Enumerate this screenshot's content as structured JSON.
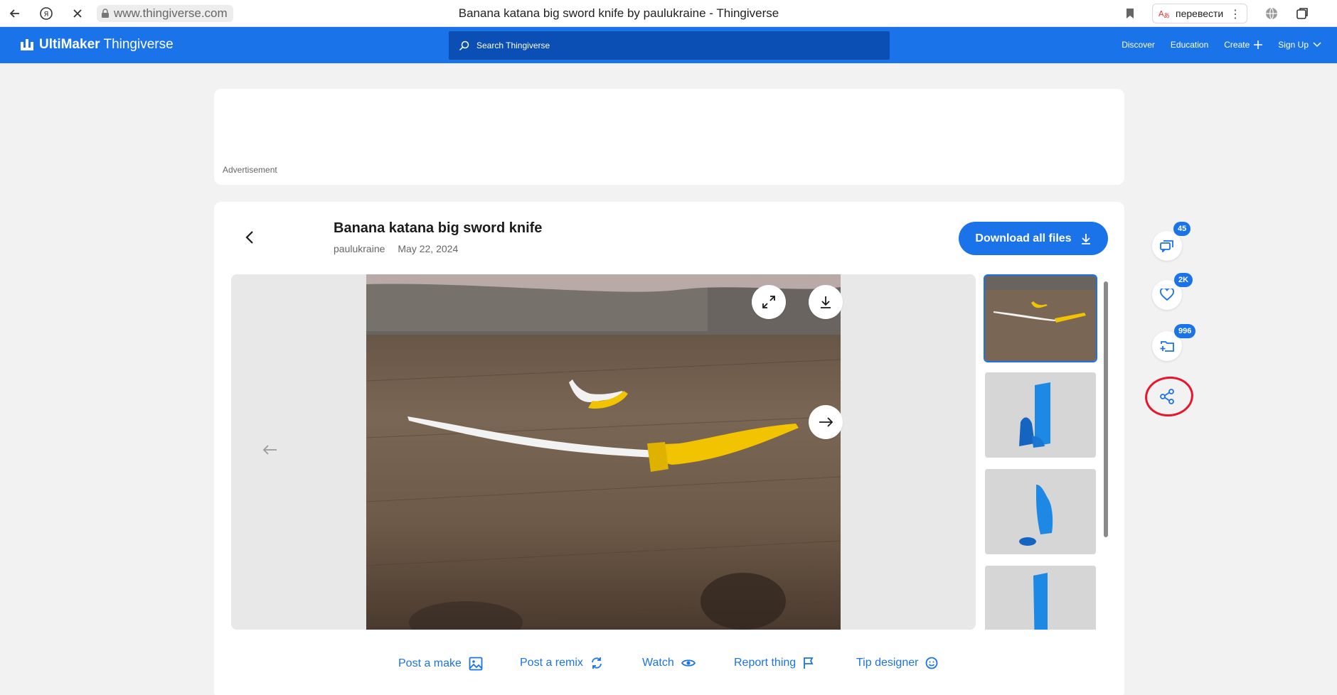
{
  "browser": {
    "url": "www.thingiverse.com",
    "tab_title": "Banana katana big sword knife by paulukraine - Thingiverse",
    "translate_label": "перевести"
  },
  "nav": {
    "logo_bold": "UltiMaker",
    "logo_light": " Thingiverse",
    "search_placeholder": "Search Thingiverse",
    "links": [
      "Discover",
      "Education",
      "Create",
      "Sign Up"
    ]
  },
  "ad": {
    "label": "Advertisement"
  },
  "thing": {
    "title": "Banana katana big sword knife",
    "author": "paulukraine",
    "date": "May 22, 2024",
    "download_label": "Download all files"
  },
  "actions": [
    "Post a make",
    "Post a remix",
    "Watch",
    "Report thing",
    "Tip designer"
  ],
  "rail": {
    "comments_count": "45",
    "likes_count": "2K",
    "collections_count": "996"
  },
  "colors": {
    "brand_blue": "#1a73e8",
    "search_bg": "#0b4fb5",
    "annotation_red": "#e8152c"
  }
}
